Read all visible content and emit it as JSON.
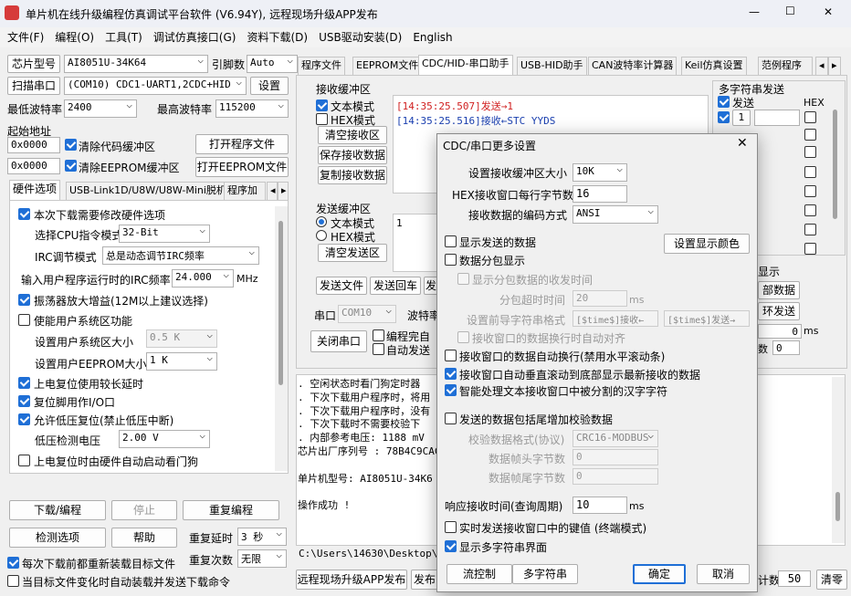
{
  "window": {
    "title": "单片机在线升级编程仿真调试平台软件 (V6.94Y), 远程现场升级APP发布",
    "min": "—",
    "max": "☐",
    "close": "✕"
  },
  "menu": [
    "文件(F)",
    "编程(O)",
    "工具(T)",
    "调试仿真接口(G)",
    "资料下载(D)",
    "USB驱动安装(D)",
    "English"
  ],
  "left": {
    "chip_label": "芯片型号",
    "chip_value": "AI8051U-34K64",
    "pin_label": "引脚数",
    "pin_value": "Auto",
    "scan_button": "扫描串口",
    "port_value": "(COM10) CDC1-UART1,2CDC+HID",
    "settings_button": "设置",
    "min_baud_label": "最低波特率",
    "min_baud_value": "2400",
    "max_baud_label": "最高波特率",
    "max_baud_value": "115200",
    "start_addr_label": "起始地址",
    "addr1": "0x0000",
    "clear_code": "清除代码缓冲区",
    "open_prog": "打开程序文件",
    "addr2": "0x0000",
    "clear_eeprom": "清除EEPROM缓冲区",
    "open_eeprom": "打开EEPROM文件",
    "tabs": [
      "硬件选项",
      "USB-Link1D/U8W/U8W-Mini脱机",
      "程序加"
    ],
    "hw": {
      "opt1": "本次下载需要修改硬件选项",
      "cpu_label": "选择CPU指令模式",
      "cpu_value": "32-Bit",
      "irc_label": "IRC调节模式",
      "irc_value": "总是动态调节IRC频率",
      "freq_label": "输入用户程序运行时的IRC频率",
      "freq_value": "24.000",
      "freq_unit": "MHz",
      "osc": "振荡器放大增益(12M以上建议选择)",
      "sysarea": "使能用户系统区功能",
      "sysarea_size_label": "设置用户系统区大小",
      "sysarea_size_value": "0.5 K",
      "eeprom_size_label": "设置用户EEPROM大小",
      "eeprom_size_value": "1   K",
      "poweron": "上电复位使用较长延时",
      "reset_io": "复位脚用作I/O口",
      "lowvolt": "允许低压复位(禁止低压中断)",
      "lowvolt_label": "低压检测电压",
      "lowvolt_value": "2.00 V",
      "watchdog": "上电复位时由硬件自动启动看门狗"
    },
    "download_button": "下载/编程",
    "stop_button": "停止",
    "reprogram_button": "重复编程",
    "detect_button": "检测选项",
    "help_button": "帮助",
    "repeat_delay_label": "重复延时",
    "repeat_delay_value": "3 秒",
    "reload_label": "每次下载前都重新装载目标文件",
    "repeat_count_label": "重复次数",
    "repeat_count_value": "无限",
    "autoload_label": "当目标文件变化时自动装载并发送下载命令"
  },
  "right": {
    "tabs": [
      "程序文件",
      "EEPROM文件",
      "CDC/HID-串口助手",
      "USB-HID助手",
      "CAN波特率计算器",
      "Keil仿真设置",
      "范例程序"
    ],
    "recv_group": "接收缓冲区",
    "text_mode": "文本模式",
    "hex_mode": "HEX模式",
    "clear_recv": "清空接收区",
    "save_recv": "保存接收数据",
    "copy_recv": "复制接收数据",
    "recv_line1_time": "[14:35:25.507]",
    "recv_line1_text": "发送→1",
    "recv_line2_time": "[14:35:25.516]",
    "recv_line2_text": "接收←STC YYDS",
    "send_group": "发送缓冲区",
    "send_text_mode": "文本模式",
    "send_hex_mode": "HEX模式",
    "clear_send": "清空发送区",
    "send_value": "1",
    "send_file": "发送文件",
    "send_enter": "发送回车",
    "send_data": "发",
    "port_label": "串口",
    "port_value": "COM10",
    "baud_label": "波特率",
    "close_port": "关闭串口",
    "encode_label": "编程完自",
    "autosend_label": "自动发送",
    "multi_title": "多字符串发送",
    "multi_send": "发送",
    "multi_hex": "HEX",
    "multi_row1": "1",
    "show_label": "显示",
    "part_data": "部数据",
    "loop_send": "环发送",
    "ms_label": "ms",
    "ms_val": "0",
    "count_val": "0",
    "dis_label": "数",
    "log": [
      ". 空闲状态时看门狗定时器",
      ". 下次下载用户程序时，将用",
      ". 下次下载用户程序时，没有",
      ". 下次下载时不需要校验下",
      ". 内部参考电压: 1188 mV",
      "芯片出厂序列号 : 78B4C9CAC",
      "",
      "  单片机型号: AI8051U-34K6",
      "",
      "操作成功 !"
    ],
    "path": "C:\\Users\\14630\\Desktop\\805",
    "remote_button": "远程现场升级APP发布",
    "publish_button": "发布",
    "count_label": "计数",
    "count_value": "50",
    "clear_button": "清零"
  },
  "dialog": {
    "title": "CDC/串口更多设置",
    "buf_label": "设置接收缓冲区大小",
    "buf_value": "10K",
    "hex_bytes_label": "HEX接收窗口每行字节数",
    "hex_bytes_value": "16",
    "encoding_label": "接收数据的编码方式",
    "encoding_value": "ANSI",
    "show_sent": "显示发送的数据",
    "display_color": "设置显示颜色",
    "split_show": "数据分包显示",
    "show_split_time": "显示分包数据的收发时间",
    "split_timeout_label": "分包超时时间",
    "split_timeout_value": "20",
    "split_timeout_unit": "ms",
    "prefix_label": "设置前导字符串格式",
    "prefix_recv": "[$time$]接收←",
    "prefix_send": "[$time$]发送→",
    "auto_align": "接收窗口的数据换行时自动对齐",
    "auto_wrap": "接收窗口的数据自动换行(禁用水平滚动条)",
    "auto_scroll": "接收窗口自动垂直滚动到底部显示最新接收的数据",
    "smart_split": "智能处理文本接收窗口中被分割的汉字字符",
    "add_checksum": "发送的数据包括尾增加校验数据",
    "check_format_label": "校验数据格式(协议)",
    "check_format_value": "CRC16-MODBUS",
    "frame_head_label": "数据帧头字节数",
    "frame_head_value": "0",
    "frame_tail_label": "数据帧尾字节数",
    "frame_tail_value": "0",
    "resp_label": "响应接收时间(查询周期)",
    "resp_value": "10",
    "resp_unit": "ms",
    "realtime": "实时发送接收窗口中的键值 (终端模式)",
    "multi_ui": "显示多字符串界面",
    "flow_button": "流控制",
    "multi_button": "多字符串",
    "ok_button": "确定",
    "cancel_button": "取消"
  }
}
